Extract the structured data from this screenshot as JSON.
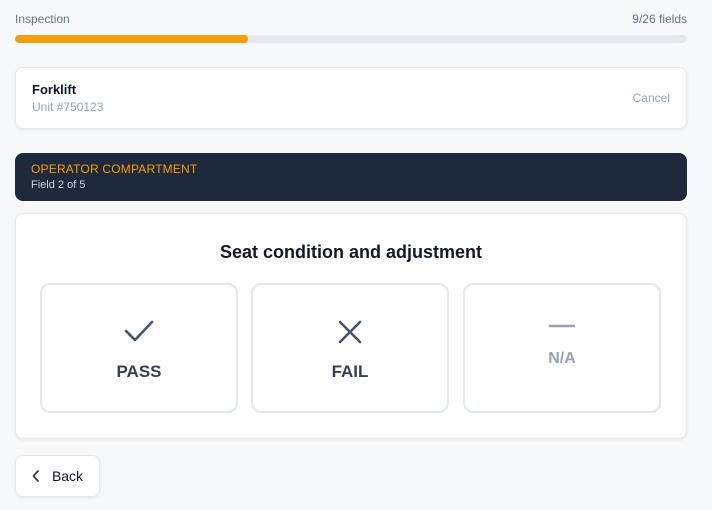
{
  "progress": {
    "label": "Inspection",
    "count_text": "9/26 fields",
    "completed": 9,
    "total": 26,
    "accent_color": "#f59e0b"
  },
  "equipment": {
    "name": "Forklift",
    "unit": "Unit #750123",
    "cancel_label": "Cancel"
  },
  "section": {
    "title": "OPERATOR COMPARTMENT",
    "subtitle": "Field 2 of 5",
    "background_color": "#1e293b"
  },
  "question": {
    "text": "Seat condition and adjustment",
    "options": [
      {
        "label": "PASS",
        "icon": "check-icon"
      },
      {
        "label": "FAIL",
        "icon": "x-icon"
      },
      {
        "label": "N/A",
        "icon": "dash-icon"
      }
    ]
  },
  "navigation": {
    "back_label": "Back",
    "back_icon": "chevron-left-icon"
  }
}
